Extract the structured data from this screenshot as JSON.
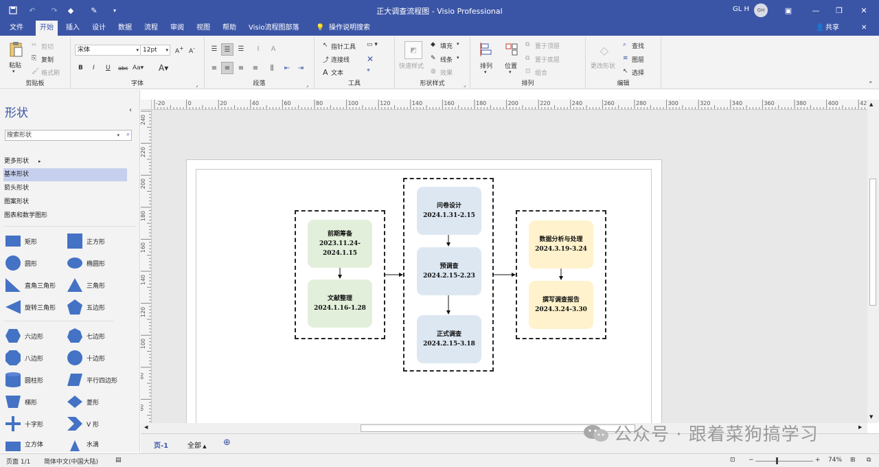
{
  "window": {
    "title": "正大调查流程图 - Visio Professional",
    "account": "GL H",
    "avatar_initials": "GH"
  },
  "menu": {
    "items": [
      "文件",
      "开始",
      "插入",
      "设计",
      "数据",
      "流程",
      "审阅",
      "视图",
      "帮助",
      "Visio流程图部落"
    ],
    "tell_me": "操作说明搜索",
    "share": "共享"
  },
  "ribbon": {
    "clipboard": {
      "label": "剪贴板",
      "paste": "粘贴",
      "cut": "剪切",
      "copy": "复制",
      "format_painter": "格式刷"
    },
    "font": {
      "label": "字体",
      "family": "宋体",
      "size": "12pt"
    },
    "paragraph": {
      "label": "段落"
    },
    "tools": {
      "label": "工具",
      "pointer": "指针工具",
      "connector": "连接线",
      "text": "文本"
    },
    "shape_styles": {
      "label": "形状样式",
      "quick_styles": "快速样式",
      "fill": "填充",
      "line": "线条",
      "effects": "效果"
    },
    "arrange": {
      "label": "排列",
      "align": "排列",
      "position": "位置",
      "bring_front": "置于顶层",
      "send_back": "置于底层",
      "group": "组合"
    },
    "editing": {
      "label": "编辑",
      "change_shape": "更改形状",
      "find": "查找",
      "layers": "图层",
      "select": "选择"
    }
  },
  "shapes_panel": {
    "title": "形状",
    "search_placeholder": "搜索形状",
    "stencils": [
      "更多形状",
      "基本形状",
      "箭头形状",
      "图案形状",
      "图表和数学图形"
    ],
    "selected_stencil": "基本形状",
    "shapes": [
      "矩形",
      "正方形",
      "圆形",
      "椭圆形",
      "直角三角形",
      "三角形",
      "旋转三角形",
      "五边形",
      "六边形",
      "七边形",
      "八边形",
      "十边形",
      "圆柱形",
      "平行四边形",
      "梯形",
      "菱形",
      "十字形",
      "V 形",
      "立方体",
      "水滴"
    ]
  },
  "ruler": {
    "h": [
      "-20",
      "0",
      "20",
      "40",
      "60",
      "80",
      "100",
      "120",
      "140",
      "160",
      "180",
      "200",
      "220",
      "240",
      "260",
      "280",
      "300",
      "320",
      "340",
      "360",
      "380",
      "400",
      "42"
    ],
    "v": [
      "240",
      "220",
      "200",
      "180",
      "160",
      "140",
      "120",
      "100",
      "80",
      "60"
    ]
  },
  "diagram": {
    "nodes": {
      "prep": {
        "title": "前期筹备",
        "date": "2023.11.24-2024.1.15"
      },
      "literature": {
        "title": "文献整理",
        "date": "2024.1.16-1.28"
      },
      "questionnaire": {
        "title": "问卷设计",
        "date": "2024.1.31-2.15"
      },
      "pre_survey": {
        "title": "预调查",
        "date": "2024.2.15-2.23"
      },
      "formal_survey": {
        "title": "正式调查",
        "date": "2024.2.15-3.18"
      },
      "analysis": {
        "title": "数据分析与处理",
        "date": "2024.3.19-3.24"
      },
      "report": {
        "title": "撰写调查报告",
        "date": "2024.3.24-3.30"
      }
    },
    "colors": {
      "green": "#e2efda",
      "blue": "#dde7f2",
      "yellow": "#fff2cc"
    }
  },
  "page_tabs": {
    "current": "页-1",
    "all": "全部"
  },
  "status": {
    "page": "页面 1/1",
    "language": "简体中文(中国大陆)",
    "zoom": "74%"
  },
  "watermark": "公众号 · 跟着菜狗搞学习"
}
